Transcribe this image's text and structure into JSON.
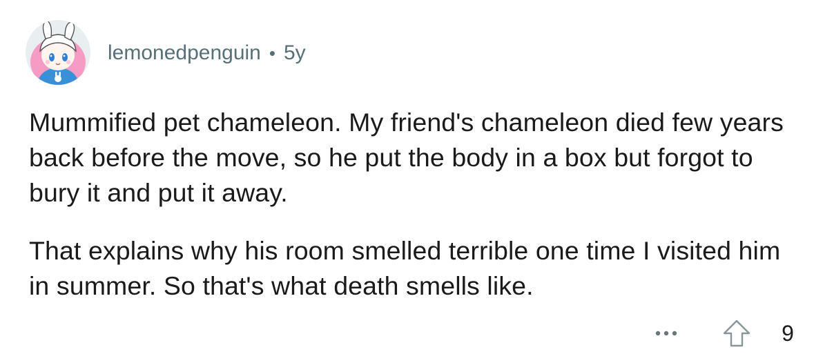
{
  "comment": {
    "author": "lemonedpenguin",
    "separator": "•",
    "age": "5y",
    "paragraphs": [
      "Mummified pet chameleon. My friend's chameleon died few years back before the move, so he put the body in a box but forgot to bury it and put it away.",
      "That explains why his room smelled terrible one time I visited him in summer. So that's what death smells like."
    ],
    "score": "9",
    "more_icon": "more-horizontal-icon",
    "upvote_icon": "upvote-arrow-icon"
  },
  "colors": {
    "meta_text": "#576f76",
    "body_text": "#1a1a1b",
    "icon_gray": "#8a9599",
    "avatar_bg": "#e9eef0",
    "avatar_shirt": "#3a8fd9",
    "avatar_hair": "#f59bc4"
  }
}
